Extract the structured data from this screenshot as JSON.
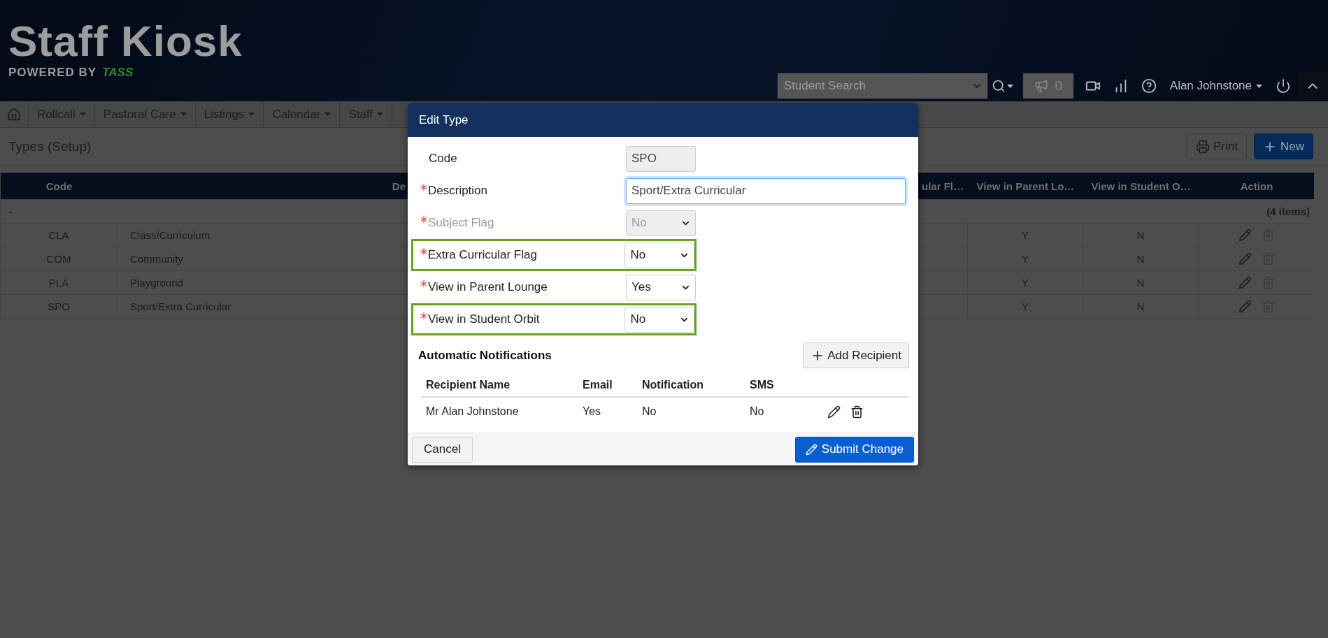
{
  "header": {
    "logo_title": "Staff Kiosk",
    "logo_subtitle": "POWERED BY",
    "logo_brand": "TASS",
    "search": {
      "placeholder": "Student Search"
    },
    "notification_count": "0",
    "user": "Alan Johnstone"
  },
  "nav": {
    "items": [
      "Rollcall",
      "Pastoral Care",
      "Listings",
      "Calendar",
      "Staff"
    ]
  },
  "page": {
    "title": "Types (Setup)",
    "buttons": [
      {
        "kind": "print",
        "label": "Print"
      },
      {
        "kind": "new",
        "label": "New"
      }
    ]
  },
  "table": {
    "columns": [
      "Code",
      "De",
      "ular Fl…",
      "View in Parent Lo…",
      "View in Student O…",
      "Action"
    ],
    "group": {
      "label": "-",
      "count": "(4 items)"
    },
    "rows": [
      {
        "code": "CLA",
        "description": "Class/Curriculum",
        "parent": "Y",
        "student": "N"
      },
      {
        "code": "COM",
        "description": "Community",
        "parent": "Y",
        "student": "N"
      },
      {
        "code": "PLA",
        "description": "Playground",
        "parent": "Y",
        "student": "N"
      },
      {
        "code": "SPO",
        "description": "Sport/Extra Curricular",
        "parent": "Y",
        "student": "N"
      }
    ]
  },
  "modal": {
    "title": "Edit Type",
    "fields": [
      {
        "kind": "text",
        "label": "Code",
        "value": "SPO",
        "required": false,
        "disabled": true,
        "highlighted": false
      },
      {
        "kind": "text",
        "label": "Description",
        "value": "Sport/Extra Curricular",
        "required": true,
        "disabled": false,
        "focused": true,
        "highlighted": false
      },
      {
        "kind": "select",
        "label": "Subject Flag",
        "value": "No",
        "required": true,
        "disabled": true,
        "highlighted": false
      },
      {
        "kind": "select",
        "label": "Extra Curricular Flag",
        "value": "No",
        "required": true,
        "disabled": false,
        "highlighted": true
      },
      {
        "kind": "select",
        "label": "View in Parent Lounge",
        "value": "Yes",
        "required": true,
        "disabled": false,
        "highlighted": false
      },
      {
        "kind": "select",
        "label": "View in Student Orbit",
        "value": "No",
        "required": true,
        "disabled": false,
        "highlighted": true
      }
    ],
    "notifications": {
      "title": "Automatic Notifications",
      "add_button": "Add Recipient",
      "columns": [
        "Recipient Name",
        "Email",
        "Notification",
        "SMS"
      ],
      "rows": [
        {
          "name": "Mr Alan Johnstone",
          "email": "Yes",
          "notification": "No",
          "sms": "No"
        }
      ]
    },
    "cancel": "Cancel",
    "submit": "Submit Change"
  }
}
